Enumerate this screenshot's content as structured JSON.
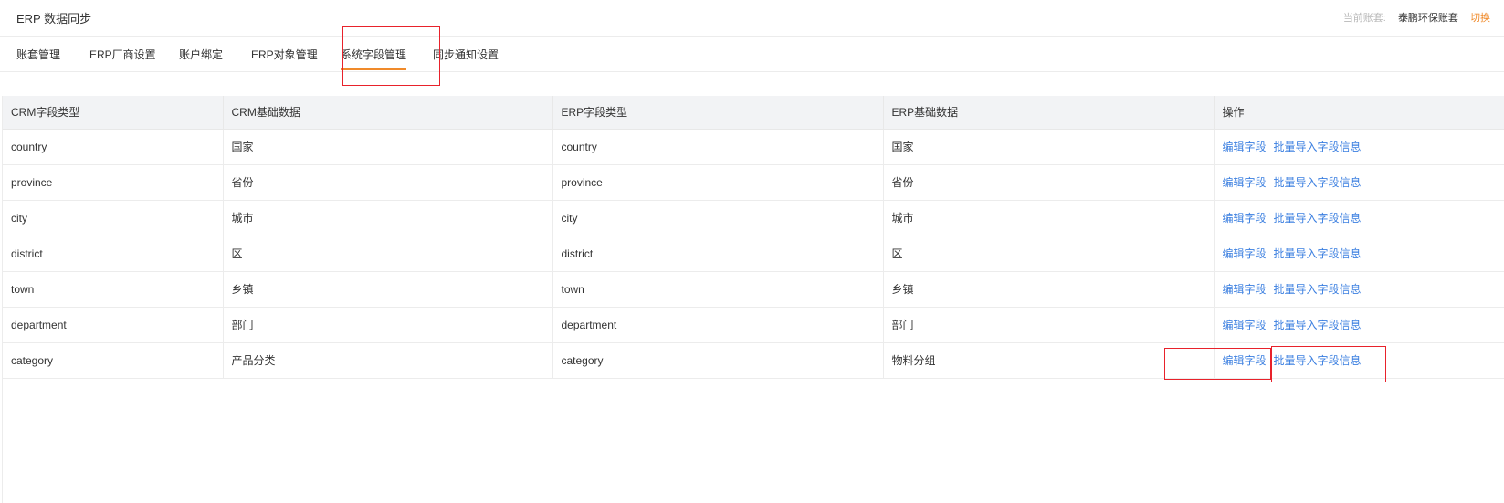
{
  "header": {
    "title": "ERP 数据同步",
    "account_label": "当前账套:",
    "account_name": "泰鹏环保账套",
    "switch_label": "切换"
  },
  "tabs": [
    {
      "label": "账套管理"
    },
    {
      "label": "ERP厂商设置"
    },
    {
      "label": "账户绑定"
    },
    {
      "label": "ERP对象管理"
    },
    {
      "label": "系统字段管理",
      "active": true
    },
    {
      "label": "同步通知设置"
    }
  ],
  "table": {
    "columns": [
      "CRM字段类型",
      "CRM基础数据",
      "ERP字段类型",
      "ERP基础数据",
      "操作"
    ],
    "rows": [
      {
        "crm_type": "country",
        "crm_base": "国家",
        "erp_type": "country",
        "erp_base": "国家"
      },
      {
        "crm_type": "province",
        "crm_base": "省份",
        "erp_type": "province",
        "erp_base": "省份"
      },
      {
        "crm_type": "city",
        "crm_base": "城市",
        "erp_type": "city",
        "erp_base": "城市"
      },
      {
        "crm_type": "district",
        "crm_base": "区",
        "erp_type": "district",
        "erp_base": "区"
      },
      {
        "crm_type": "town",
        "crm_base": "乡镇",
        "erp_type": "town",
        "erp_base": "乡镇"
      },
      {
        "crm_type": "department",
        "crm_base": "部门",
        "erp_type": "department",
        "erp_base": "部门"
      },
      {
        "crm_type": "category",
        "crm_base": "产品分类",
        "erp_type": "category",
        "erp_base": "物料分组"
      }
    ],
    "actions": {
      "edit": "编辑字段",
      "import": "批量导入字段信息"
    }
  },
  "colors": {
    "accent": "#f08a2a",
    "link": "#3b7fe0",
    "highlight": "#e8222b"
  }
}
